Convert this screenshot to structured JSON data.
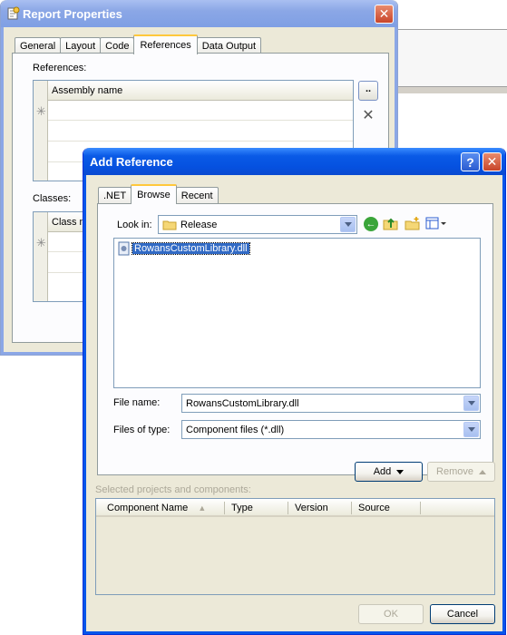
{
  "report_properties": {
    "title": "Report Properties",
    "tabs": [
      "General",
      "Layout",
      "Code",
      "References",
      "Data Output"
    ],
    "references_label": "References:",
    "assembly_column": "Assembly name",
    "browse_button": "..",
    "classes_label": "Classes:",
    "class_column": "Class na"
  },
  "add_reference": {
    "title": "Add Reference",
    "tabs": [
      ".NET",
      "Browse",
      "Recent"
    ],
    "look_in_label": "Look in:",
    "look_in_value": "Release",
    "files": [
      "RowansCustomLibrary.dll"
    ],
    "file_name_label": "File name:",
    "file_name_value": "RowansCustomLibrary.dll",
    "files_of_type_label": "Files of type:",
    "files_of_type_value": "Component files (*.dll)",
    "add_button": "Add",
    "remove_button": "Remove",
    "selected_label": "Selected projects and components:",
    "columns": [
      "Component Name",
      "Type",
      "Version",
      "Source"
    ],
    "ok_button": "OK",
    "cancel_button": "Cancel"
  },
  "colors": {
    "active_title": "#0551e0",
    "inactive_title": "#8ba7e6",
    "dialog_face": "#ece9d8",
    "tab_highlight": "#ffc83c",
    "selection": "#316ac5"
  }
}
